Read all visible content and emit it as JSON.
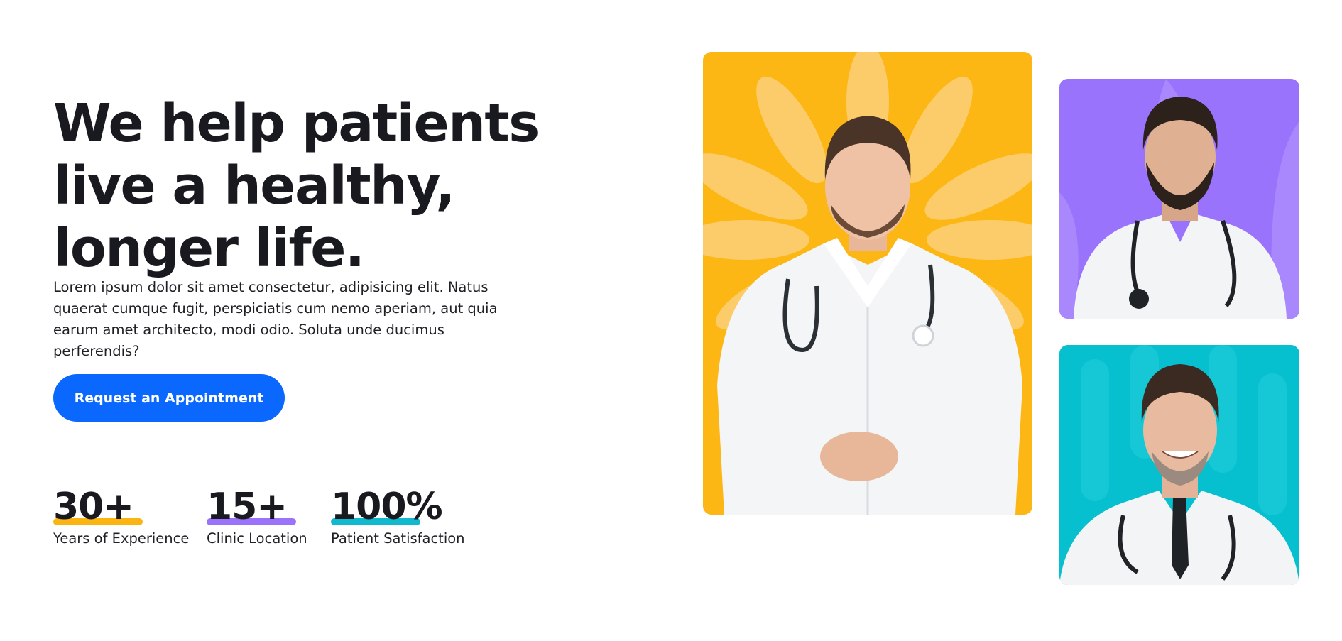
{
  "hero": {
    "title_lines": [
      "We help patients",
      "live a healthy,",
      "longer life."
    ],
    "description": "Lorem ipsum dolor sit amet consectetur, adipisicing elit. Natus quaerat cumque fugit, perspiciatis cum nemo aperiam, aut quia earum amet architecto, modi odio. Soluta unde ducimus perferendis?",
    "cta_label": "Request an Appointment"
  },
  "stats": [
    {
      "value": "30+",
      "label": "Years of Experience",
      "accent": "#fbb512"
    },
    {
      "value": "15+",
      "label": "Clinic Location",
      "accent": "#9b73fb"
    },
    {
      "value": "100%",
      "label": "Patient Satisfaction",
      "accent": "#11b9cf"
    }
  ],
  "colors": {
    "primary_button": "#0a68fe",
    "card_yellow": "#fdb714",
    "card_purple": "#9a73fc",
    "card_teal": "#06bfcf"
  },
  "images": [
    {
      "name": "doctor-portrait-main",
      "background": "yellow with flower petals"
    },
    {
      "name": "doctor-portrait-bearded",
      "background": "purple"
    },
    {
      "name": "doctor-portrait-smiling",
      "background": "teal"
    }
  ]
}
